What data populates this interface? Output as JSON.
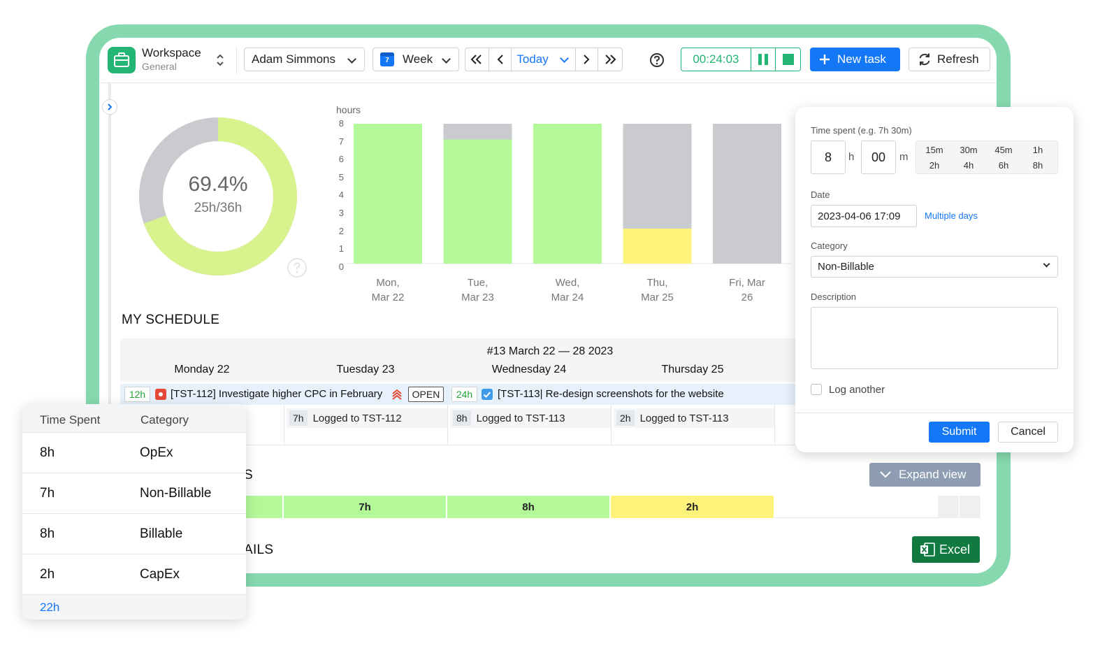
{
  "workspace": {
    "title": "Workspace",
    "subtitle": "General"
  },
  "toolbar": {
    "user": "Adam Simmons",
    "view": "Week",
    "calendar_day": "7",
    "today": "Today",
    "timer": "00:24:03",
    "new_task": "New task",
    "refresh": "Refresh"
  },
  "donut": {
    "percent": "69.4%",
    "hours": "25h/36h",
    "fraction": 0.694
  },
  "colors": {
    "green": "#b3f99a",
    "gray": "#c9cbce",
    "yellow": "#fdf37a",
    "accent": "#1477f8",
    "brand": "#22b573"
  },
  "chart_data": {
    "type": "bar",
    "ylabel": "hours",
    "ylim": [
      0,
      8
    ],
    "yticks": [
      "8",
      "7",
      "6",
      "5",
      "4",
      "3",
      "2",
      "1",
      "0"
    ],
    "categories": [
      [
        "Mon,",
        "Mar 22"
      ],
      [
        "Tue,",
        "Mar 23"
      ],
      [
        "Wed,",
        "Mar 24"
      ],
      [
        "Thu,",
        "Mar 25"
      ],
      [
        "Fri, Mar",
        "26"
      ]
    ],
    "series": [
      {
        "values": [
          8,
          7.1,
          8,
          2,
          0
        ],
        "color": "green_or_yellow"
      },
      {
        "values": [
          0,
          0.9,
          0,
          6,
          8
        ],
        "color": "gray"
      }
    ]
  },
  "schedule": {
    "title": "MY SCHEDULE",
    "week_label": "#13 March 22 — 28 2023",
    "days": [
      "Monday 22",
      "Tuesday 23",
      "Wednesday 24",
      "Thursday 25"
    ],
    "task1": {
      "hours": "12h",
      "text": "[TST-112] Investigate higher CPC in February",
      "status": "OPEN"
    },
    "task2": {
      "hours": "24h",
      "text": "[TST-113| Re-design screenshots for the website"
    },
    "logs": [
      {
        "hours": "7h",
        "text": "Logged to TST-112"
      },
      {
        "hours": "8h",
        "text": "Logged to TST-113"
      },
      {
        "hours": "2h",
        "text": "Logged to TST-113"
      }
    ]
  },
  "categories_section": {
    "title_fragment": "S",
    "bars": [
      "7h",
      "8h",
      "2h"
    ],
    "expand_view": "Expand view"
  },
  "details_section": {
    "title_fragment": "AILS",
    "excel": "Excel"
  },
  "log_panel": {
    "time_label": "Time spent (e.g. 7h 30m)",
    "hours_value": "8",
    "hours_unit": "h",
    "minutes_value": "00",
    "minutes_unit": "m",
    "quick_top": [
      "15m",
      "30m",
      "45m",
      "1h"
    ],
    "quick_bottom": [
      "2h",
      "4h",
      "6h",
      "8h"
    ],
    "date_label": "Date",
    "date_value": "2023-04-06 17:09",
    "multiple_days": "Multiple days",
    "category_label": "Category",
    "category_value": "Non-Billable",
    "description_label": "Description",
    "log_another": "Log another",
    "submit": "Submit",
    "cancel": "Cancel"
  },
  "summary_table": {
    "headers": [
      "Time Spent",
      "Category"
    ],
    "rows": [
      {
        "time": "8h",
        "category": "OpEx"
      },
      {
        "time": "7h",
        "category": "Non-Billable"
      },
      {
        "time": "8h",
        "category": "Billable"
      },
      {
        "time": "2h",
        "category": "CapEx"
      }
    ],
    "total": "22h"
  }
}
